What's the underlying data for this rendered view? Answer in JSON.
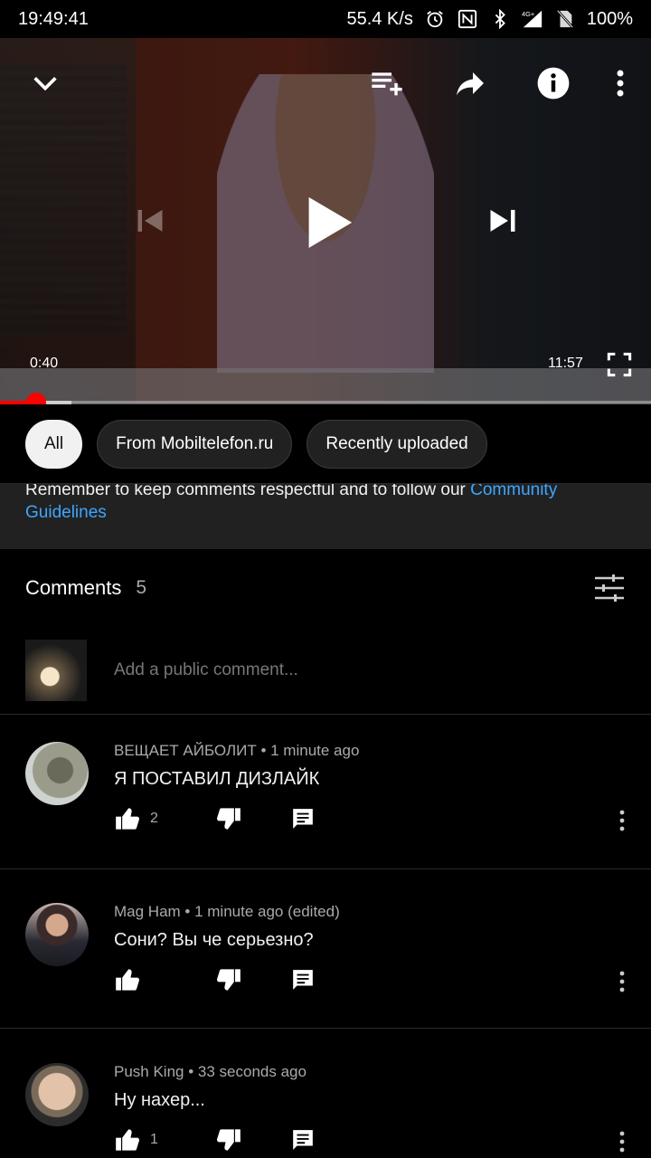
{
  "status_bar": {
    "time": "19:49:41",
    "net_speed": "55.4 K/s",
    "battery": "100%",
    "icons": [
      "alarm-icon",
      "nfc-icon",
      "bluetooth-icon",
      "signal-4g-icon",
      "no-sim-icon"
    ]
  },
  "player": {
    "current_time": "0:40",
    "duration": "11:57",
    "progress_fraction": 0.056,
    "buffered_fraction": 0.11,
    "icons": [
      "collapse-chevron-icon",
      "add-to-queue-icon",
      "share-icon",
      "info-icon",
      "more-vert-icon",
      "previous-icon",
      "play-icon",
      "next-icon",
      "fullscreen-icon"
    ]
  },
  "chips": [
    {
      "label": "All",
      "active": true
    },
    {
      "label": "From Mobiltelefon.ru",
      "active": false
    },
    {
      "label": "Recently uploaded",
      "active": false
    }
  ],
  "notice": {
    "text": "Remember to keep comments respectful and to follow our ",
    "link": "Community Guidelines"
  },
  "comments_header": {
    "title": "Comments",
    "count": "5"
  },
  "add_comment": {
    "placeholder": "Add a public comment..."
  },
  "comments": [
    {
      "author": "ВЕЩАЕТ АЙБОЛИТ",
      "time": "1 minute ago",
      "text": "Я ПОСТАВИЛ ДИЗЛАЙК",
      "likes": "2"
    },
    {
      "author": "Mag Ham",
      "time": "1 minute ago (edited)",
      "text": "Сони? Вы че серьезно?",
      "likes": ""
    },
    {
      "author": "Push King",
      "time": "33 seconds ago",
      "text": "Ну нахер...",
      "likes": "1"
    }
  ],
  "colors": {
    "progress_red": "#ff0000",
    "link_blue": "#3ea6ff",
    "chip_bg": "#212121"
  }
}
